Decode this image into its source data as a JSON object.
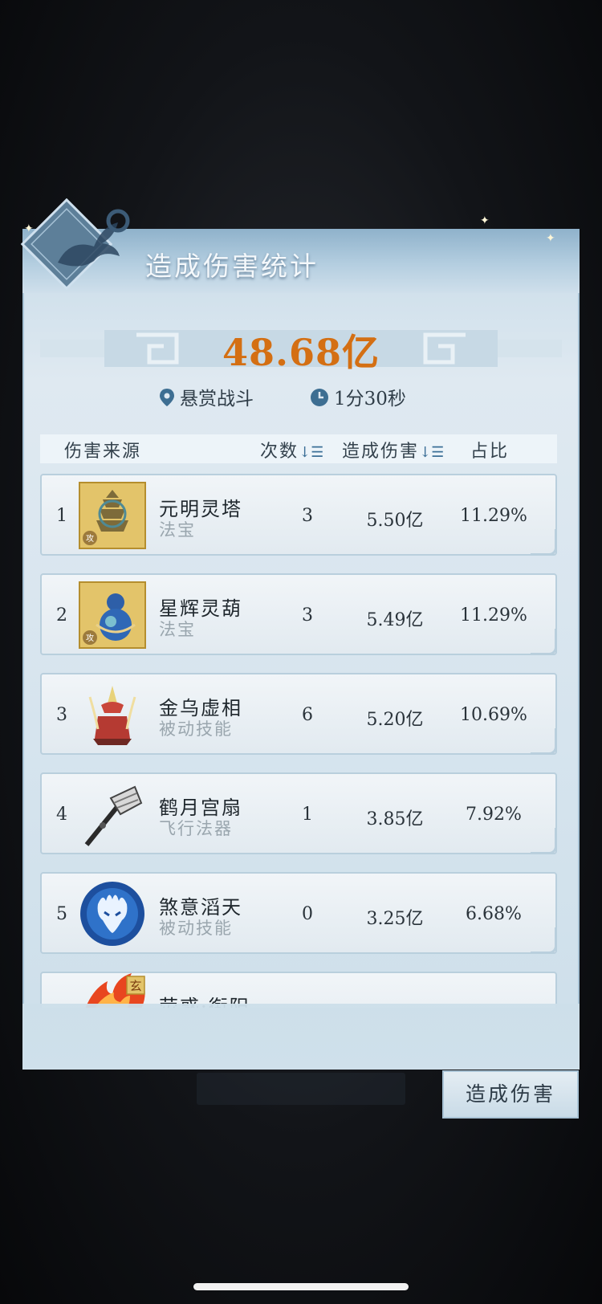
{
  "dialog": {
    "title": "造成伤害统计",
    "total": "48.68亿",
    "location_label": "悬赏战斗",
    "duration_label": "1分30秒"
  },
  "table": {
    "headers": {
      "source": "伤害来源",
      "count": "次数",
      "damage": "造成伤害",
      "ratio": "占比"
    },
    "rows": [
      {
        "rank": "1",
        "name": "元明灵塔",
        "category": "法宝",
        "count": "3",
        "damage": "5.50亿",
        "ratio": "11.29%",
        "icon": "pagoda-icon",
        "badge": "攻"
      },
      {
        "rank": "2",
        "name": "星辉灵葫",
        "category": "法宝",
        "count": "3",
        "damage": "5.49亿",
        "ratio": "11.29%",
        "icon": "gourd-icon",
        "badge": "攻"
      },
      {
        "rank": "3",
        "name": "金乌虚相",
        "category": "被动技能",
        "count": "6",
        "damage": "5.20亿",
        "ratio": "10.69%",
        "icon": "golden-crow-icon"
      },
      {
        "rank": "4",
        "name": "鹤月宫扇",
        "category": "飞行法器",
        "count": "1",
        "damage": "3.85亿",
        "ratio": "7.92%",
        "icon": "fan-icon"
      },
      {
        "rank": "5",
        "name": "煞意滔天",
        "category": "被动技能",
        "count": "0",
        "damage": "3.25亿",
        "ratio": "6.68%",
        "icon": "flame-mask-icon"
      },
      {
        "rank": "",
        "name": "荧惑·衔阳",
        "category": "",
        "count": "",
        "damage": "",
        "ratio": "",
        "icon": "fire-icon",
        "badge": "玄"
      }
    ]
  },
  "tab_button": "造成伤害",
  "colors": {
    "total": "#d46f13",
    "accent": "#3c6f97"
  }
}
